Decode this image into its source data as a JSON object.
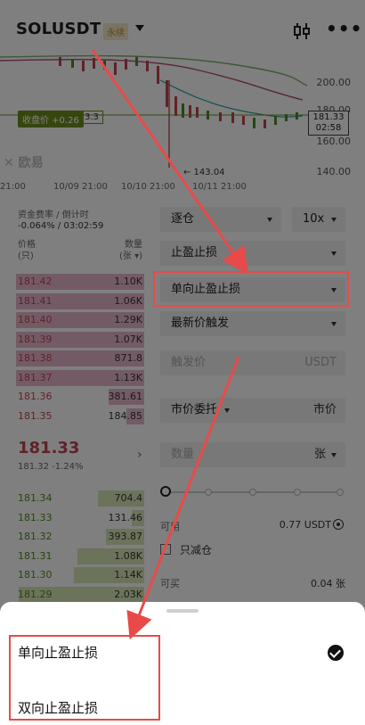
{
  "header": {
    "pair": "SOLUSDT",
    "perp_tag": "永续",
    "chart_icon": "candlestick-icon",
    "more_icon": "more-icon"
  },
  "chart": {
    "price_axis": [
      "200.00",
      "180.00",
      "160.00",
      "140.00"
    ],
    "current_price": "181.33",
    "countdown": "02:58",
    "last_price_badge": "收盘价 +0.26",
    "last_price_badge_extra": "3.3",
    "low_marker": "← 143.04",
    "watermark": "✕ 欧易",
    "time_labels": [
      "21:00",
      "10/09 21:00",
      "10/10 21:00",
      "10/11 21:00"
    ]
  },
  "funding": {
    "title": "资金费率 / 倒计时",
    "value": "-0.064% / 03:02:59"
  },
  "orderbook": {
    "price_header": "价格",
    "price_unit": "(只)",
    "qty_header": "数量",
    "qty_unit": "(张 ▾)",
    "asks": [
      {
        "price": "181.42",
        "qty": "1.10K",
        "depth": 1.0
      },
      {
        "price": "181.41",
        "qty": "1.06K",
        "depth": 1.0
      },
      {
        "price": "181.40",
        "qty": "1.29K",
        "depth": 1.0
      },
      {
        "price": "181.39",
        "qty": "1.07K",
        "depth": 1.0
      },
      {
        "price": "181.38",
        "qty": "871.8",
        "depth": 1.0
      },
      {
        "price": "181.37",
        "qty": "1.13K",
        "depth": 1.0
      },
      {
        "price": "181.36",
        "qty": "381.61",
        "depth": 0.28
      },
      {
        "price": "181.35",
        "qty": "184.85",
        "depth": 0.14
      }
    ],
    "mid_price": "181.33",
    "mid_sub": "181.32  -1.24%",
    "bids": [
      {
        "price": "181.34",
        "qty": "704.4",
        "depth": 0.36
      },
      {
        "price": "181.33",
        "qty": "131.46",
        "depth": 0.1
      },
      {
        "price": "181.32",
        "qty": "393.87",
        "depth": 0.3
      },
      {
        "price": "181.31",
        "qty": "1.08K",
        "depth": 0.52
      },
      {
        "price": "181.30",
        "qty": "1.14K",
        "depth": 0.55
      },
      {
        "price": "181.29",
        "qty": "2.03K",
        "depth": 0.98
      }
    ]
  },
  "form": {
    "margin_mode": "逐仓",
    "leverage": "10x",
    "tpsl_mode": "止盈止损",
    "tpsl_type": "单向止盈止损",
    "trigger_type": "最新价触发",
    "trigger_placeholder": "触发价",
    "trigger_unit": "USDT",
    "order_type": "市价委托",
    "order_price": "市价",
    "qty_placeholder": "数量",
    "qty_unit": "张",
    "available_label": "可用",
    "available_value": "0.77 USDT",
    "reduce_only": "只减仓",
    "can_buy_label": "可买",
    "can_buy_value": "0.04 张"
  },
  "sheet": {
    "options": [
      "单向止盈止损",
      "双向止盈止损"
    ],
    "selected_index": 0
  },
  "colors": {
    "ask": "#c0454f",
    "bid": "#4f8a1f",
    "annotation": "#e84a4a"
  }
}
